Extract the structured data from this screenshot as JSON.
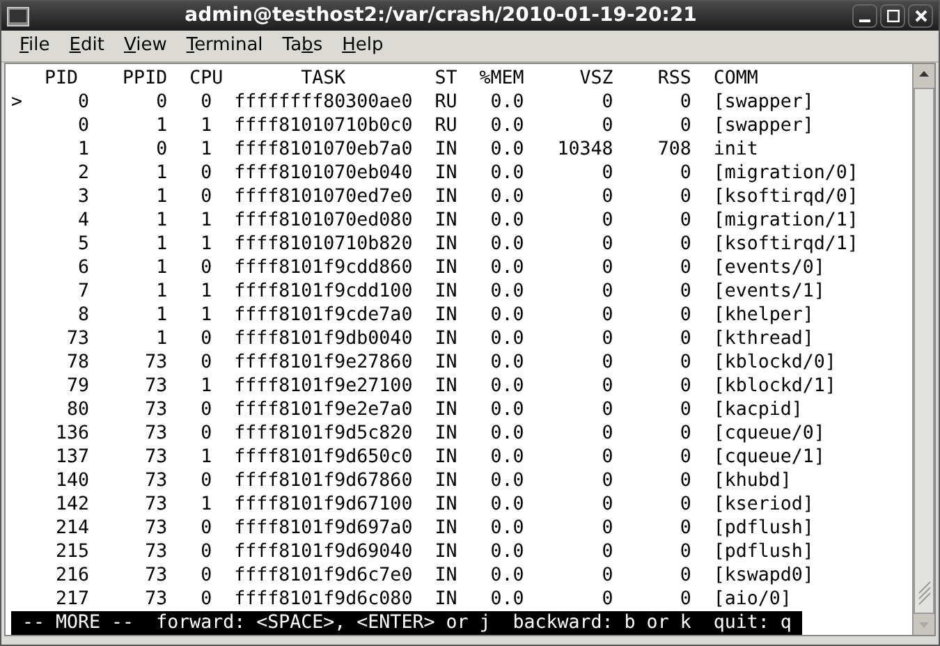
{
  "window": {
    "title": "admin@testhost2:/var/crash/2010-01-19-20:21"
  },
  "menu": [
    {
      "key": "F",
      "rest": "ile"
    },
    {
      "key": "E",
      "rest": "dit"
    },
    {
      "key": "V",
      "rest": "iew"
    },
    {
      "key": "T",
      "rest": "erminal"
    },
    {
      "head": "Ta",
      "key": "b",
      "rest": "s"
    },
    {
      "key": "H",
      "rest": "elp"
    }
  ],
  "terminal": {
    "lines": [
      "   PID    PPID  CPU       TASK        ST  %MEM     VSZ    RSS  COMM",
      ">     0      0   0  ffffffff80300ae0  RU   0.0       0      0  [swapper]",
      "      0      1   1  ffff81010710b0c0  RU   0.0       0      0  [swapper]",
      "      1      0   1  ffff8101070eb7a0  IN   0.0   10348    708  init",
      "      2      1   0  ffff8101070eb040  IN   0.0       0      0  [migration/0]",
      "      3      1   0  ffff8101070ed7e0  IN   0.0       0      0  [ksoftirqd/0]",
      "      4      1   1  ffff8101070ed080  IN   0.0       0      0  [migration/1]",
      "      5      1   1  ffff81010710b820  IN   0.0       0      0  [ksoftirqd/1]",
      "      6      1   0  ffff8101f9cdd860  IN   0.0       0      0  [events/0]",
      "      7      1   1  ffff8101f9cdd100  IN   0.0       0      0  [events/1]",
      "      8      1   1  ffff8101f9cde7a0  IN   0.0       0      0  [khelper]",
      "     73      1   0  ffff8101f9db0040  IN   0.0       0      0  [kthread]",
      "     78     73   0  ffff8101f9e27860  IN   0.0       0      0  [kblockd/0]",
      "     79     73   1  ffff8101f9e27100  IN   0.0       0      0  [kblockd/1]",
      "     80     73   0  ffff8101f9e2e7a0  IN   0.0       0      0  [kacpid]",
      "    136     73   0  ffff8101f9d5c820  IN   0.0       0      0  [cqueue/0]",
      "    137     73   1  ffff8101f9d650c0  IN   0.0       0      0  [cqueue/1]",
      "    140     73   0  ffff8101f9d67860  IN   0.0       0      0  [khubd]",
      "    142     73   1  ffff8101f9d67100  IN   0.0       0      0  [kseriod]",
      "    214     73   0  ffff8101f9d697a0  IN   0.0       0      0  [pdflush]",
      "    215     73   0  ffff8101f9d69040  IN   0.0       0      0  [pdflush]",
      "    216     73   0  ffff8101f9d6c7e0  IN   0.0       0      0  [kswapd0]",
      "    217     73   0  ffff8101f9d6c080  IN   0.0       0      0  [aio/0]"
    ],
    "prompt": " -- MORE --  forward: <SPACE>, <ENTER> or j  backward: b or k  quit: q "
  }
}
